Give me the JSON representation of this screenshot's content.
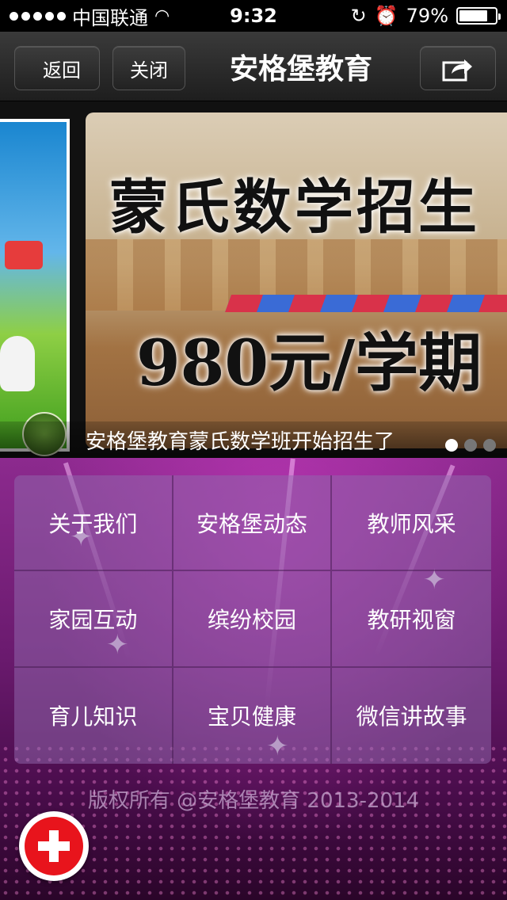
{
  "status_bar": {
    "carrier": "中国联通",
    "time": "9:32",
    "battery": "79%",
    "battery_level": 0.79,
    "icons": [
      "signal-dots-icon",
      "wifi-icon",
      "rotation-lock-icon",
      "alarm-icon",
      "battery-icon"
    ]
  },
  "nav": {
    "back_label": "返回",
    "close_label": "关闭",
    "title": "安格堡教育",
    "share_icon": "share-icon"
  },
  "banner": {
    "headline": "蒙氏数学招生",
    "price": "980元/学期",
    "caption": "安格堡教育蒙氏数学班开始招生了",
    "slide_count": 3,
    "active_slide": 1
  },
  "menu": {
    "items": [
      {
        "label": "关于我们"
      },
      {
        "label": "安格堡动态"
      },
      {
        "label": "教师风采"
      },
      {
        "label": "家园互动"
      },
      {
        "label": "缤纷校园"
      },
      {
        "label": "教研视窗"
      },
      {
        "label": "育儿知识"
      },
      {
        "label": "宝贝健康"
      },
      {
        "label": "微信讲故事"
      }
    ]
  },
  "footer": {
    "copyright": "版权所有 @安格堡教育 2013-2014"
  },
  "fab": {
    "icon": "plus-icon",
    "color": "#e8141c"
  }
}
